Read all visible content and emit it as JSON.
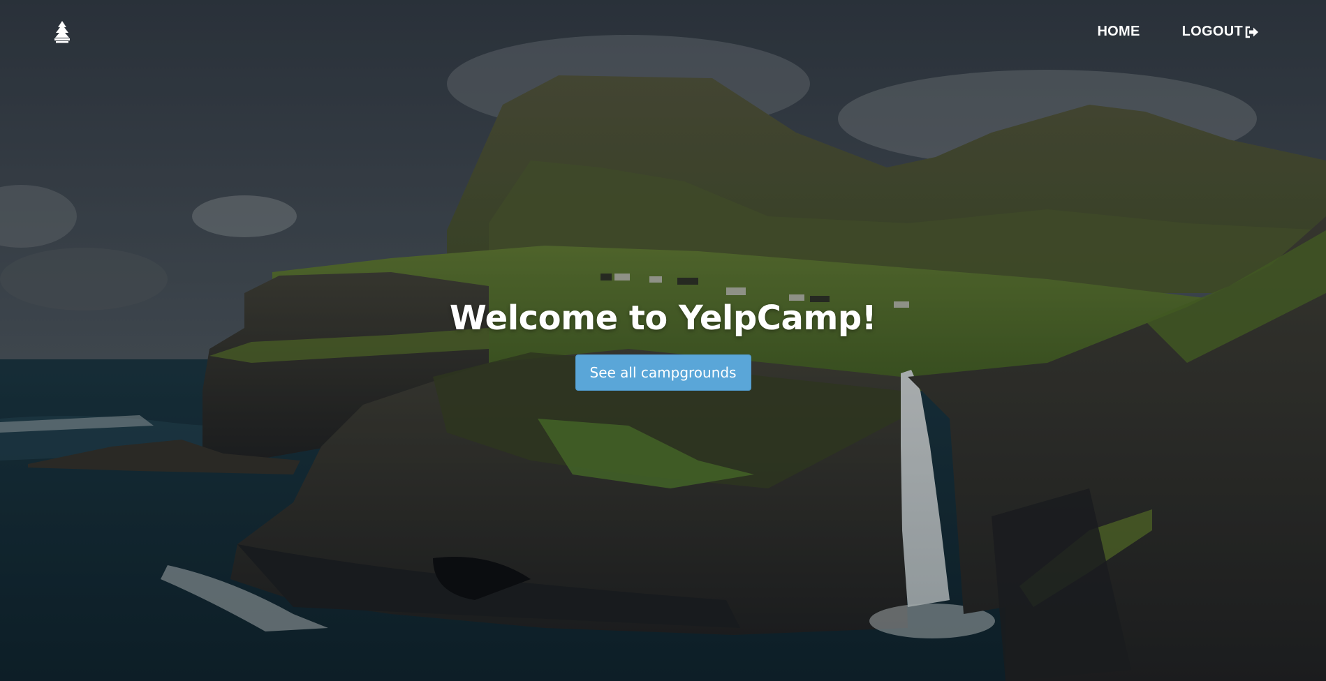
{
  "nav": {
    "brand_icon": "campfire-tree-icon",
    "home_label": "HOME",
    "logout_label": "LOGOUT",
    "logout_icon": "logout-arrow-icon"
  },
  "hero": {
    "title": "Welcome to YelpCamp!",
    "button_label": "See all campgrounds",
    "button_color": "#5aa6d8"
  },
  "background": {
    "description_icon": "cliff-waterfall-landscape-photo"
  }
}
